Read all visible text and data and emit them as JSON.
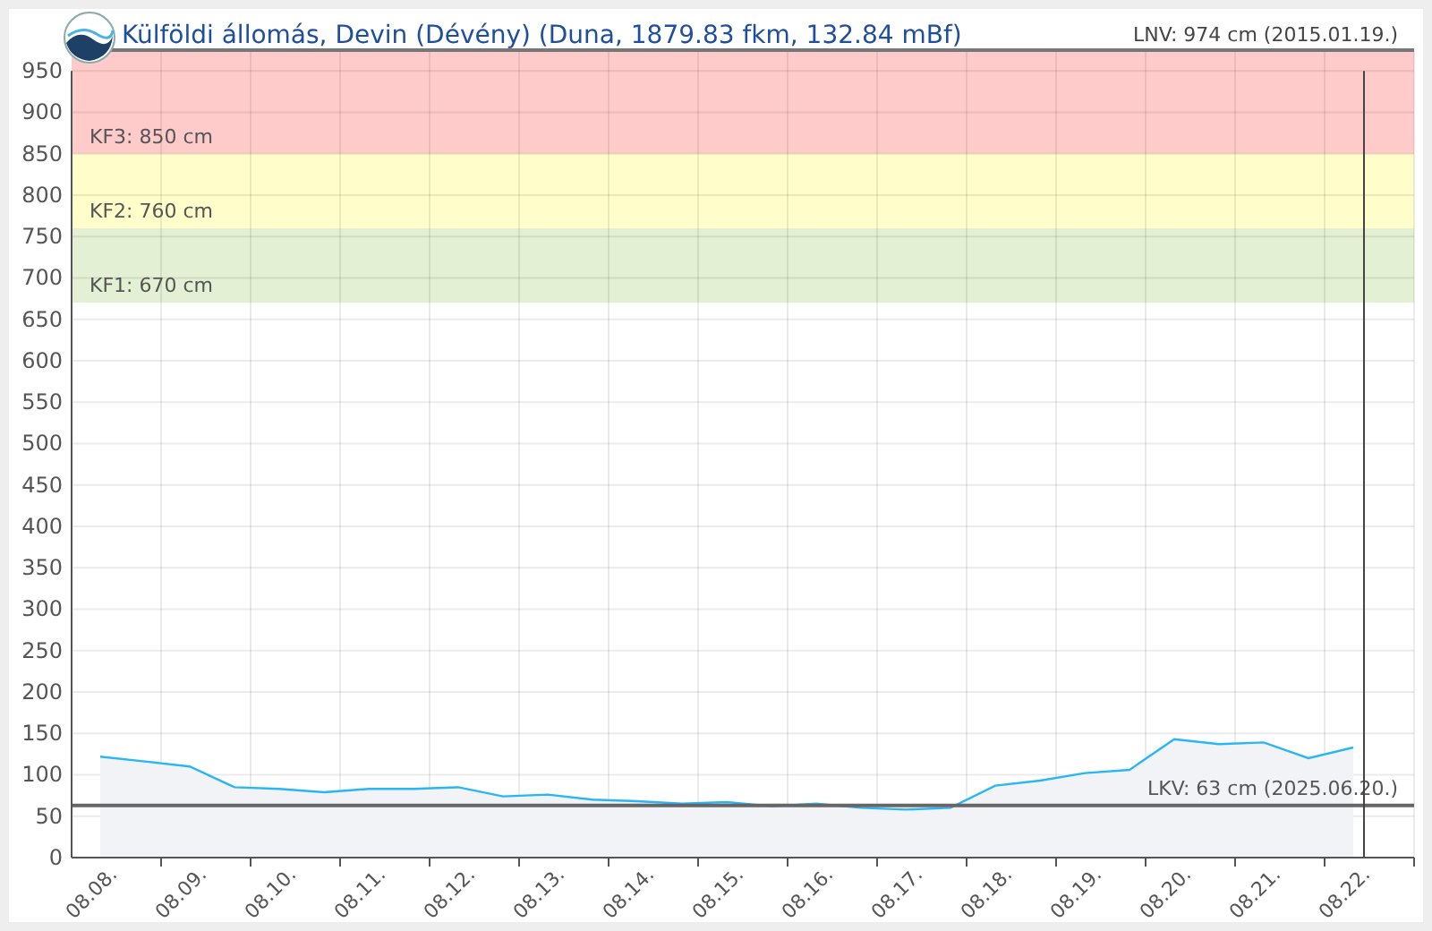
{
  "title": "Külföldi állomás, Devin (Dévény) (Duna, 1879.83 fkm, 132.84 mBf)",
  "record_high_label": "LNV: 974 cm (2015.01.19.)",
  "chart_data": {
    "type": "area",
    "ylim": [
      0,
      975
    ],
    "grid": true,
    "categories": [
      "08.08.",
      null,
      "08.09.",
      null,
      "08.10.",
      null,
      "08.11.",
      null,
      "08.12.",
      null,
      "08.13.",
      null,
      "08.14.",
      null,
      "08.15.",
      null,
      "08.16.",
      null,
      "08.17.",
      null,
      "08.18.",
      null,
      "08.19.",
      null,
      "08.20.",
      null,
      "08.21.",
      null,
      "08.22."
    ],
    "yticks": [
      0,
      50,
      100,
      150,
      200,
      250,
      300,
      350,
      400,
      450,
      500,
      550,
      600,
      650,
      700,
      750,
      800,
      850,
      900,
      950
    ],
    "series": [
      {
        "color": "#29b6f6",
        "values": [
          122,
          116,
          110,
          85,
          83,
          79,
          83,
          83,
          85,
          74,
          76,
          70,
          68,
          65,
          67,
          62,
          65,
          60,
          58,
          60,
          87,
          93,
          102,
          106,
          143,
          137,
          139,
          120,
          133
        ]
      }
    ],
    "bands": [
      {
        "axis": "y",
        "from": 670,
        "to": 760,
        "label": "KF1: 670 cm",
        "color": "#e3f0d3"
      },
      {
        "axis": "y",
        "from": 760,
        "to": 850,
        "label": "KF2: 760 cm",
        "color": "#fffdca"
      },
      {
        "axis": "y",
        "from": 850,
        "to": 975,
        "label": "KF3: 850 cm",
        "color": "#ffcaca"
      }
    ],
    "ref_lines": [
      {
        "axis": "y",
        "value": 63,
        "label": "LKV: 63 cm (2025.06.20.)"
      },
      {
        "axis": "x",
        "value": "08.22."
      }
    ]
  }
}
